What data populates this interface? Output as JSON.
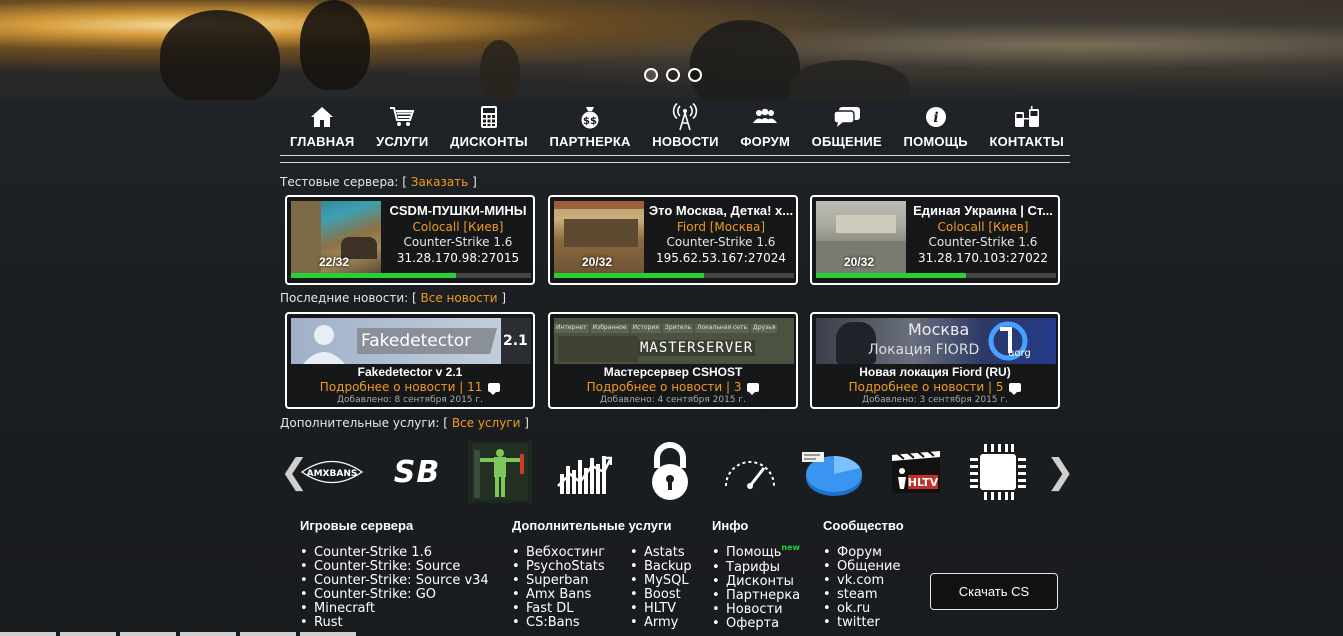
{
  "nav": {
    "items": [
      {
        "label": "ГЛАВНАЯ",
        "icon": "home-icon"
      },
      {
        "label": "УСЛУГИ",
        "icon": "cart-icon"
      },
      {
        "label": "ДИСКОНТЫ",
        "icon": "calculator-icon"
      },
      {
        "label": "ПАРТНЕРКА",
        "icon": "money-bag-icon"
      },
      {
        "label": "НОВОСТИ",
        "icon": "broadcast-icon"
      },
      {
        "label": "ФОРУМ",
        "icon": "people-icon"
      },
      {
        "label": "ОБЩЕНИЕ",
        "icon": "chat-icon"
      },
      {
        "label": "ПОМОЩЬ",
        "icon": "info-icon"
      },
      {
        "label": "КОНТАКТЫ",
        "icon": "phones-icon"
      }
    ]
  },
  "servers_section": {
    "title": "Тестовые сервера:",
    "bracket_open": "[",
    "link": "Заказать",
    "bracket_close": "]"
  },
  "servers": [
    {
      "name": "CSDM-ПУШКИ-МИНЫ",
      "location": "Colocall [Киев]",
      "game": "Counter-Strike 1.6",
      "ip": "31.28.170.98:27015",
      "slots": "22/32",
      "fill": 0.6875
    },
    {
      "name": "Это Москва, Детка! x...",
      "location": "Fiord [Москва]",
      "game": "Counter-Strike 1.6",
      "ip": "195.62.53.167:27024",
      "slots": "20/32",
      "fill": 0.625
    },
    {
      "name": "Единая Украина | Ст...",
      "location": "Colocall [Киев]",
      "game": "Counter-Strike 1.6",
      "ip": "31.28.170.103:27022",
      "slots": "20/32",
      "fill": 0.625
    }
  ],
  "news_section": {
    "title": "Последние новости:",
    "bracket_open": "[",
    "link": "Все новости",
    "bracket_close": "]"
  },
  "news": [
    {
      "title": "Fakedetector v 2.1",
      "link": "Подробнее о новости",
      "sep": "|",
      "comments": "11",
      "date": "Добавлено: 8 сентября 2015 г.",
      "img_text": "Fakedetector",
      "img_ver": "2.1"
    },
    {
      "title": "Мастерсервер CSHOST",
      "link": "Подробнее о новости",
      "sep": "|",
      "comments": "3",
      "date": "Добавлено: 4 сентября 2015 г.",
      "img_text": "MASTERSERVER",
      "img_tabs": [
        "Интернет",
        "Избранное",
        "История",
        "Зритель",
        "Локальная сеть",
        "Друзья"
      ]
    },
    {
      "title": "Новая локация Fiord (RU)",
      "link": "Подробнее о новости",
      "sep": "|",
      "comments": "5",
      "date": "Добавлено: 3 сентября 2015 г.",
      "img_text1": "Москва",
      "img_text2": "Локация FIORD",
      "img_text3": "uorg"
    }
  ],
  "services_section": {
    "title": "Дополнительные услуги:",
    "bracket_open": "[",
    "link": "Все услуги",
    "bracket_close": "]"
  },
  "services": [
    {
      "name": "amxbans-logo",
      "text": "AMXBANS"
    },
    {
      "name": "sourcebans-logo",
      "text": "SB"
    },
    {
      "name": "model-icon",
      "text": ""
    },
    {
      "name": "stats-chart-icon",
      "text": ""
    },
    {
      "name": "lock-icon",
      "text": ""
    },
    {
      "name": "speedometer-icon",
      "text": ""
    },
    {
      "name": "pie-chart-icon",
      "text": ""
    },
    {
      "name": "hltv-icon",
      "text": "HLTV"
    },
    {
      "name": "chip-icon",
      "text": ""
    }
  ],
  "carousel": {
    "prev": "❮",
    "next": "❯"
  },
  "footer": {
    "game_servers": {
      "title": "Игровые сервера",
      "items": [
        "Counter-Strike 1.6",
        "Counter-Strike: Source",
        "Counter-Strike: Source v34",
        "Counter-Strike: GO",
        "Minecraft",
        "Rust"
      ]
    },
    "extra_services": {
      "title": "Дополнительные услуги",
      "col1": [
        "Вебхостинг",
        "PsychoStats",
        "Superban",
        "Amx Bans",
        "Fast DL",
        "CS:Bans"
      ],
      "col2": [
        "Astats",
        "Backup",
        "MySQL",
        "Boost",
        "HLTV",
        "Army"
      ]
    },
    "info": {
      "title": "Инфо",
      "items": [
        "Помощь",
        "Тарифы",
        "Дисконты",
        "Партнерка",
        "Новости",
        "Оферта"
      ],
      "new_badge": "new"
    },
    "community": {
      "title": "Сообщество",
      "items": [
        "Форум",
        "Общение",
        "vk.com",
        "steam",
        "ok.ru",
        "twitter"
      ]
    },
    "download_button": "Скачать CS"
  },
  "colors": {
    "accent": "#f39a1e",
    "bar_fill": "#26d036",
    "background": "#1b1e21"
  }
}
